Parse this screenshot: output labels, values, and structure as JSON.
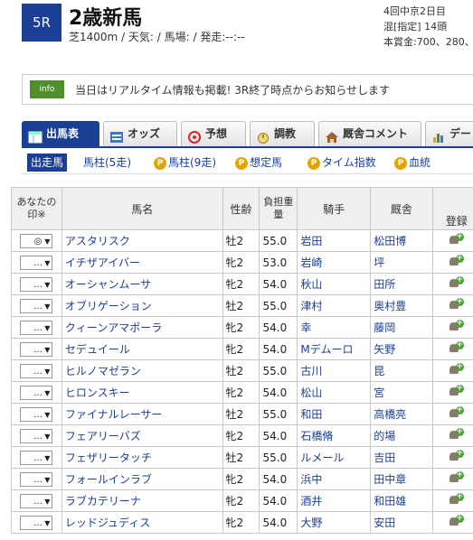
{
  "race": {
    "number": "5R",
    "name": "2歳新馬",
    "conditions": "芝1400m / 天気: / 馬場: / 発走:--:--",
    "meeting": "4回中京2日目",
    "class": "混[指定] 14頭",
    "prize": "本賞金:700、280、"
  },
  "notice": {
    "tag": "info",
    "text": "当日はリアルタイム情報も掲載! 3R終了時点からお知らせします"
  },
  "tabs": [
    {
      "label": "出馬表",
      "icon": "table-icon"
    },
    {
      "label": "オッズ",
      "icon": "odds-icon"
    },
    {
      "label": "予想",
      "icon": "target-icon"
    },
    {
      "label": "調教",
      "icon": "stopwatch-icon"
    },
    {
      "label": "厩舎コメント",
      "icon": "house-icon"
    },
    {
      "label": "デー",
      "icon": "bar-chart-icon"
    }
  ],
  "subnav": [
    {
      "label": "出走馬",
      "p": false
    },
    {
      "label": "馬柱(5走)",
      "p": false
    },
    {
      "label": "馬柱(9走)",
      "p": true
    },
    {
      "label": "想定馬",
      "p": true
    },
    {
      "label": "タイム指数",
      "p": true
    },
    {
      "label": "血統",
      "p": true
    }
  ],
  "p_badge": "P",
  "columns": {
    "mark": "あなたの印※",
    "name": "馬名",
    "sexage": "性齢",
    "weight": "負担重量",
    "jockey": "騎手",
    "stable": "厩舎",
    "register": "登録"
  },
  "rows": [
    {
      "mark": "◎",
      "name": "アスタリスク",
      "sexage": "牡2",
      "weight": "55.0",
      "jockey": "岩田",
      "stable": "松田博"
    },
    {
      "mark": "…",
      "name": "イチザアイバー",
      "sexage": "牝2",
      "weight": "53.0",
      "jockey": "岩崎",
      "stable": "坪"
    },
    {
      "mark": "…",
      "name": "オーシャンムーサ",
      "sexage": "牝2",
      "weight": "54.0",
      "jockey": "秋山",
      "stable": "田所"
    },
    {
      "mark": "…",
      "name": "オブリゲーション",
      "sexage": "牡2",
      "weight": "55.0",
      "jockey": "津村",
      "stable": "奥村豊"
    },
    {
      "mark": "…",
      "name": "クィーンアマポーラ",
      "sexage": "牝2",
      "weight": "54.0",
      "jockey": "幸",
      "stable": "藤岡"
    },
    {
      "mark": "…",
      "name": "セデュイール",
      "sexage": "牝2",
      "weight": "54.0",
      "jockey": "Mデムーロ",
      "stable": "矢野"
    },
    {
      "mark": "…",
      "name": "ヒルノマゼラン",
      "sexage": "牡2",
      "weight": "55.0",
      "jockey": "古川",
      "stable": "昆"
    },
    {
      "mark": "…",
      "name": "ヒロンスキー",
      "sexage": "牝2",
      "weight": "54.0",
      "jockey": "松山",
      "stable": "宮"
    },
    {
      "mark": "…",
      "name": "ファイナルレーサー",
      "sexage": "牡2",
      "weight": "55.0",
      "jockey": "和田",
      "stable": "高橋亮"
    },
    {
      "mark": "…",
      "name": "フェアリーバズ",
      "sexage": "牝2",
      "weight": "54.0",
      "jockey": "石橋脩",
      "stable": "的場"
    },
    {
      "mark": "…",
      "name": "フェザリータッチ",
      "sexage": "牡2",
      "weight": "55.0",
      "jockey": "ルメール",
      "stable": "吉田"
    },
    {
      "mark": "…",
      "name": "フォールインラブ",
      "sexage": "牝2",
      "weight": "54.0",
      "jockey": "浜中",
      "stable": "田中章"
    },
    {
      "mark": "…",
      "name": "ラブカテリーナ",
      "sexage": "牝2",
      "weight": "54.0",
      "jockey": "酒井",
      "stable": "和田雄"
    },
    {
      "mark": "…",
      "name": "レッドジュディス",
      "sexage": "牝2",
      "weight": "54.0",
      "jockey": "大野",
      "stable": "安田"
    }
  ]
}
